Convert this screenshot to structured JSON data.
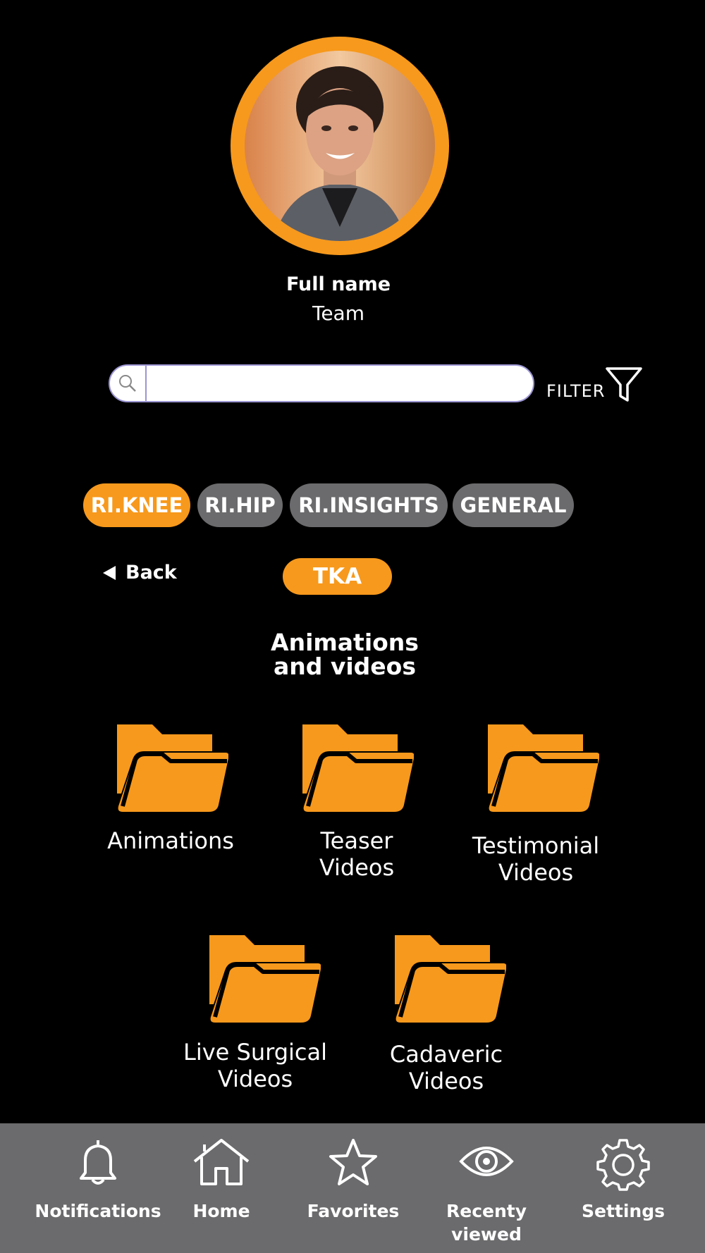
{
  "profile": {
    "full_name": "Full name",
    "team": "Team"
  },
  "search": {
    "placeholder": "",
    "value": "",
    "filter_label": "FILTER"
  },
  "tabs": [
    {
      "label": "RI.KNEE",
      "active": true
    },
    {
      "label": "RI.HIP",
      "active": false
    },
    {
      "label": "RI.INSIGHTS",
      "active": false
    },
    {
      "label": "GENERAL",
      "active": false
    }
  ],
  "navigation": {
    "back_label": "Back",
    "current_pill": "TKA"
  },
  "section": {
    "title_line1": "Animations",
    "title_line2": "and videos"
  },
  "folders": [
    {
      "line1": "Animations",
      "line2": ""
    },
    {
      "line1": "Teaser",
      "line2": "Videos"
    },
    {
      "line1": "Testimonial",
      "line2": "Videos"
    },
    {
      "line1": "Live Surgical",
      "line2": "Videos"
    },
    {
      "line1": "Cadaveric",
      "line2": "Videos"
    }
  ],
  "bottom_nav": [
    {
      "label_line1": "Notifications",
      "label_line2": "",
      "icon": "bell-icon"
    },
    {
      "label_line1": "Home",
      "label_line2": "",
      "icon": "home-icon"
    },
    {
      "label_line1": "Favorites",
      "label_line2": "",
      "icon": "star-icon"
    },
    {
      "label_line1": "Recenty",
      "label_line2": "viewed",
      "icon": "eye-icon"
    },
    {
      "label_line1": "Settings",
      "label_line2": "",
      "icon": "gear-icon"
    }
  ],
  "colors": {
    "accent": "#F7991C",
    "inactive_tab": "#6b6b6d",
    "bottom_bar": "#6b6b6d",
    "background": "#000000",
    "search_border": "#9b95d2"
  }
}
